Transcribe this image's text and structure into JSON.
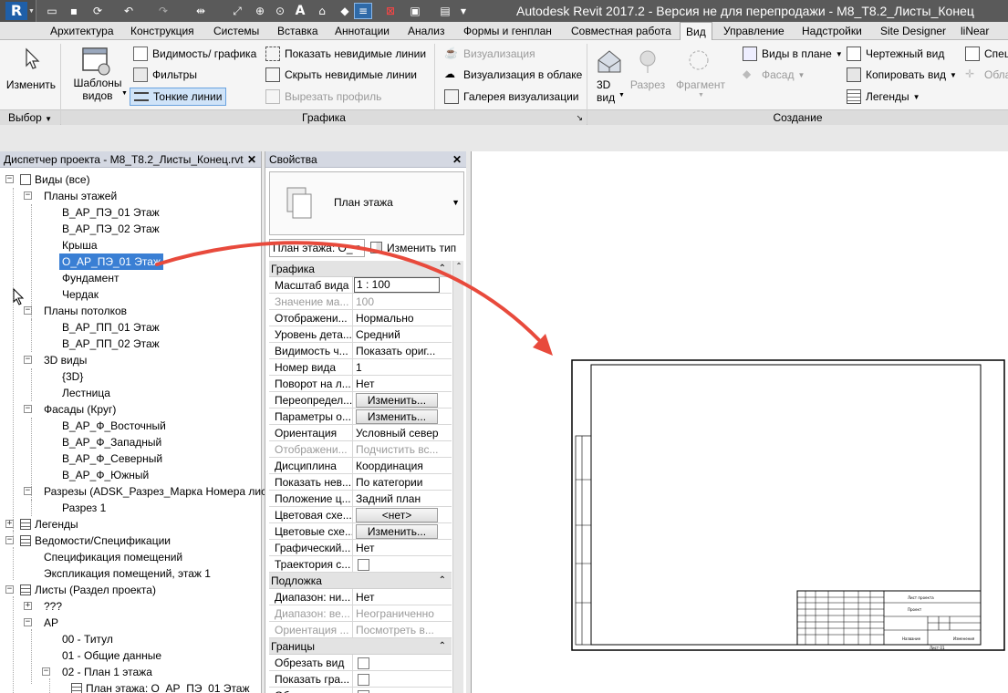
{
  "title_bar": {
    "app_letter": "R",
    "title": "Autodesk Revit 2017.2 - Версия не для перепродажи -    M8_T8.2_Листы_Конец",
    "sheet_stamp_label": "A"
  },
  "tabs": [
    {
      "label": "Архитектура",
      "active": false
    },
    {
      "label": "Конструкция",
      "active": false
    },
    {
      "label": "Системы",
      "active": false
    },
    {
      "label": "Вставка",
      "active": false
    },
    {
      "label": "Аннотации",
      "active": false
    },
    {
      "label": "Анализ",
      "active": false
    },
    {
      "label": "Формы и генплан",
      "active": false
    },
    {
      "label": "Совместная работа",
      "active": false
    },
    {
      "label": "Вид",
      "active": true
    },
    {
      "label": "Управление",
      "active": false
    },
    {
      "label": "Надстройки",
      "active": false
    },
    {
      "label": "Site Designer",
      "active": false
    },
    {
      "label": "liNear",
      "active": false
    }
  ],
  "ribbon": {
    "modify": "Изменить",
    "templates": "Шаблоны\nвидов",
    "visibility_graphics": "Видимость/ графика",
    "filters": "Фильтры",
    "thin_lines": "Тонкие линии",
    "show_hidden_lines": "Показать невидимые линии",
    "hide_hidden_lines": "Скрыть невидимые линии",
    "cut_profile": "Вырезать профиль",
    "render": "Визуализация",
    "render_cloud": "Визуализация  в облаке",
    "render_gallery": "Галерея  визуализации",
    "view_3d": "3D\nвид",
    "section": "Разрез",
    "callout": "Фрагмент",
    "plan_views": "Виды в плане",
    "elevation": "Фасад",
    "drafting_view": "Чертежный вид",
    "duplicate_view": "Копировать вид",
    "legends": "Легенды",
    "schedules": "Спец",
    "scope_box": "Обла",
    "groups": {
      "select": "Выбор",
      "graphics": "Графика",
      "create": "Создание"
    }
  },
  "project_browser": {
    "title": "Диспетчер проекта - M8_T8.2_Листы_Конец.rvt",
    "items": [
      {
        "label": "Виды (все)",
        "level": 0,
        "expander": "-",
        "icon": "views-icon"
      },
      {
        "label": "Планы этажей",
        "level": 1,
        "expander": "-"
      },
      {
        "label": "В_АР_ПЭ_01 Этаж",
        "level": 2
      },
      {
        "label": "В_АР_ПЭ_02 Этаж",
        "level": 2
      },
      {
        "label": "Крыша",
        "level": 2
      },
      {
        "label": "О_АР_ПЭ_01 Этаж",
        "level": 2,
        "selected": true
      },
      {
        "label": "Фундамент",
        "level": 2
      },
      {
        "label": "Чердак",
        "level": 2
      },
      {
        "label": "Планы потолков",
        "level": 1,
        "expander": "-"
      },
      {
        "label": "В_АР_ПП_01 Этаж",
        "level": 2
      },
      {
        "label": "В_АР_ПП_02 Этаж",
        "level": 2
      },
      {
        "label": "3D виды",
        "level": 1,
        "expander": "-"
      },
      {
        "label": "{3D}",
        "level": 2
      },
      {
        "label": "Лестница",
        "level": 2
      },
      {
        "label": "Фасады (Круг)",
        "level": 1,
        "expander": "-"
      },
      {
        "label": "В_АР_Ф_Восточный",
        "level": 2
      },
      {
        "label": "В_АР_Ф_Западный",
        "level": 2
      },
      {
        "label": "В_АР_Ф_Северный",
        "level": 2
      },
      {
        "label": "В_АР_Ф_Южный",
        "level": 2
      },
      {
        "label": "Разрезы (ADSK_Разрез_Марка Номера листа)",
        "level": 1,
        "expander": "-"
      },
      {
        "label": "Разрез 1",
        "level": 2
      },
      {
        "label": "Легенды",
        "level": 0,
        "expander": "+",
        "icon": "legend-icon"
      },
      {
        "label": "Ведомости/Спецификации",
        "level": 0,
        "expander": "-",
        "icon": "schedule-icon"
      },
      {
        "label": "Спецификация помещений",
        "level": 1
      },
      {
        "label": "Экспликация помещений, этаж 1",
        "level": 1
      },
      {
        "label": "Листы (Раздел проекта)",
        "level": 0,
        "expander": "-",
        "icon": "sheets-icon"
      },
      {
        "label": "???",
        "level": 1,
        "expander": "+"
      },
      {
        "label": "АР",
        "level": 1,
        "expander": "-"
      },
      {
        "label": "00 - Титул",
        "level": 2
      },
      {
        "label": "01 - Общие данные",
        "level": 2
      },
      {
        "label": "02 - План 1 этажа",
        "level": 2,
        "expander": "-"
      },
      {
        "label": "План этажа: О_АР_ПЭ_01 Этаж",
        "level": 3,
        "icon": "view-icon"
      }
    ]
  },
  "properties": {
    "title": "Свойства",
    "type_name": "План этажа",
    "instance_filter": "План этажа: О_",
    "edit_type": "Изменить тип",
    "sections": [
      {
        "label": "Графика",
        "top": 0
      },
      {
        "label": "Подложка",
        "top": 0
      },
      {
        "label": "Границы",
        "top": 0
      }
    ],
    "rows": [
      {
        "k": "Масштаб вида",
        "v": "1 : 100",
        "kind": "input"
      },
      {
        "k": "Значение ма...",
        "v": "100",
        "kind": "dis"
      },
      {
        "k": "Отображени...",
        "v": "Нормально"
      },
      {
        "k": "Уровень дета...",
        "v": "Средний"
      },
      {
        "k": "Видимость ч...",
        "v": "Показать ориг..."
      },
      {
        "k": "Номер вида",
        "v": "1"
      },
      {
        "k": "Поворот на л...",
        "v": "Нет"
      },
      {
        "k": "Переопредел...",
        "v": "Изменить...",
        "kind": "btn"
      },
      {
        "k": "Параметры о...",
        "v": "Изменить...",
        "kind": "btn"
      },
      {
        "k": "Ориентация",
        "v": "Условный север"
      },
      {
        "k": "Отображени...",
        "v": "Подчистить вс...",
        "kind": "dis"
      },
      {
        "k": "Дисциплина",
        "v": "Координация"
      },
      {
        "k": "Показать нев...",
        "v": "По категории"
      },
      {
        "k": "Положение ц...",
        "v": "Задний план"
      },
      {
        "k": "Цветовая схе...",
        "v": "<нет>",
        "kind": "btn"
      },
      {
        "k": "Цветовые схе...",
        "v": "Изменить...",
        "kind": "btn"
      },
      {
        "k": "Графический...",
        "v": "Нет"
      },
      {
        "k": "Траектория с...",
        "v": "",
        "kind": "chk"
      }
    ],
    "underlay_rows": [
      {
        "k": "Диапазон: ни...",
        "v": "Нет"
      },
      {
        "k": "Диапазон: ве...",
        "v": "Неограниченно",
        "kind": "dis"
      },
      {
        "k": "Ориентация ...",
        "v": "Посмотреть в...",
        "kind": "dis"
      }
    ],
    "extents_rows": [
      {
        "k": "Обрезать вид",
        "v": "",
        "kind": "chk"
      },
      {
        "k": "Показать гра...",
        "v": "",
        "kind": "chk"
      },
      {
        "k": "Обрезать анн...",
        "v": "",
        "kind": "chk"
      }
    ]
  },
  "sheet": {
    "title_block_lines": [
      "Лист проекта",
      "Проект",
      "Название",
      "Изменения",
      "Лист 01"
    ]
  },
  "colors": {
    "accent": "#3a7fd4",
    "arrow": "#e84a3c",
    "titlebar": "#5a5a5a"
  }
}
